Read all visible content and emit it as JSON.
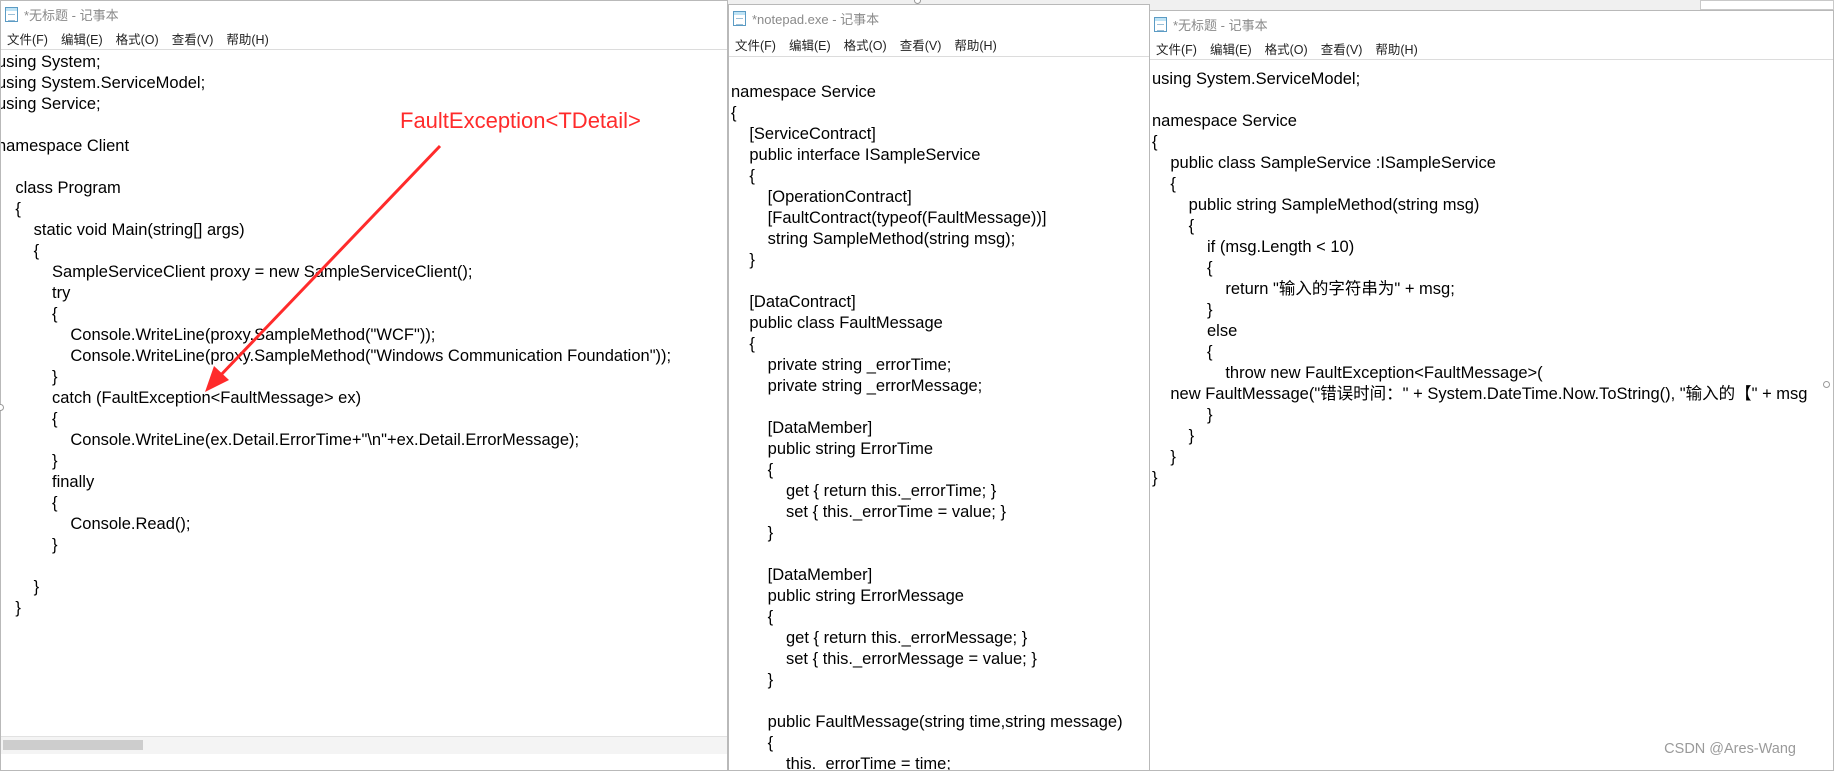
{
  "menu": [
    "文件(F)",
    "编辑(E)",
    "格式(O)",
    "查看(V)",
    "帮助(H)"
  ],
  "windows": {
    "client": {
      "title": "*无标题 - 记事本",
      "lines": [
        "using System;",
        "using System.ServiceModel;",
        "using Service;",
        "",
        "namespace Client",
        "",
        "    class Program",
        "    {",
        "        static void Main(string[] args)",
        "        {",
        "            SampleServiceClient proxy = new SampleServiceClient();",
        "            try",
        "            {",
        "                Console.WriteLine(proxy.SampleMethod(\"WCF\"));",
        "                Console.WriteLine(proxy.SampleMethod(\"Windows Communication Foundation\"));",
        "            }",
        "            catch (FaultException<FaultMessage> ex)",
        "            {",
        "                Console.WriteLine(ex.Detail.ErrorTime+\"\\n\"+ex.Detail.ErrorMessage);",
        "            }",
        "            finally",
        "            {",
        "                Console.Read();",
        "            }",
        "",
        "        }",
        "    }"
      ]
    },
    "contract": {
      "title": "*notepad.exe - 记事本",
      "lines": [
        "",
        "namespace Service",
        "{",
        "    [ServiceContract]",
        "    public interface ISampleService",
        "    {",
        "        [OperationContract]",
        "        [FaultContract(typeof(FaultMessage))]",
        "        string SampleMethod(string msg);",
        "    }",
        "",
        "    [DataContract]",
        "    public class FaultMessage",
        "    {",
        "        private string _errorTime;",
        "        private string _errorMessage;",
        "",
        "        [DataMember]",
        "        public string ErrorTime",
        "        {",
        "            get { return this._errorTime; }",
        "            set { this._errorTime = value; }",
        "        }",
        "",
        "        [DataMember]",
        "        public string ErrorMessage",
        "        {",
        "            get { return this._errorMessage; }",
        "            set { this._errorMessage = value; }",
        "        }",
        "",
        "        public FaultMessage(string time,string message)",
        "        {",
        "            this._errorTime = time;"
      ]
    },
    "service": {
      "title": "*无标题 - 记事本",
      "lines": [
        "using System.ServiceModel;",
        "",
        "namespace Service",
        "{",
        "    public class SampleService :ISampleService",
        "    {",
        "        public string SampleMethod(string msg)",
        "        {",
        "            if (msg.Length < 10)",
        "            {",
        "                return \"输入的字符串为\" + msg;",
        "            }",
        "            else",
        "            {",
        "                throw new FaultException<FaultMessage>(",
        "    new FaultMessage(\"错误时间：\" + System.DateTime.Now.ToString(), \"输入的【\" + msg",
        "            }",
        "        }",
        "    }",
        "}"
      ]
    }
  },
  "annotation": "FaultException<TDetail>",
  "watermark": "CSDN @Ares-Wang",
  "colors": {
    "annotation": "#ff2b2b"
  }
}
